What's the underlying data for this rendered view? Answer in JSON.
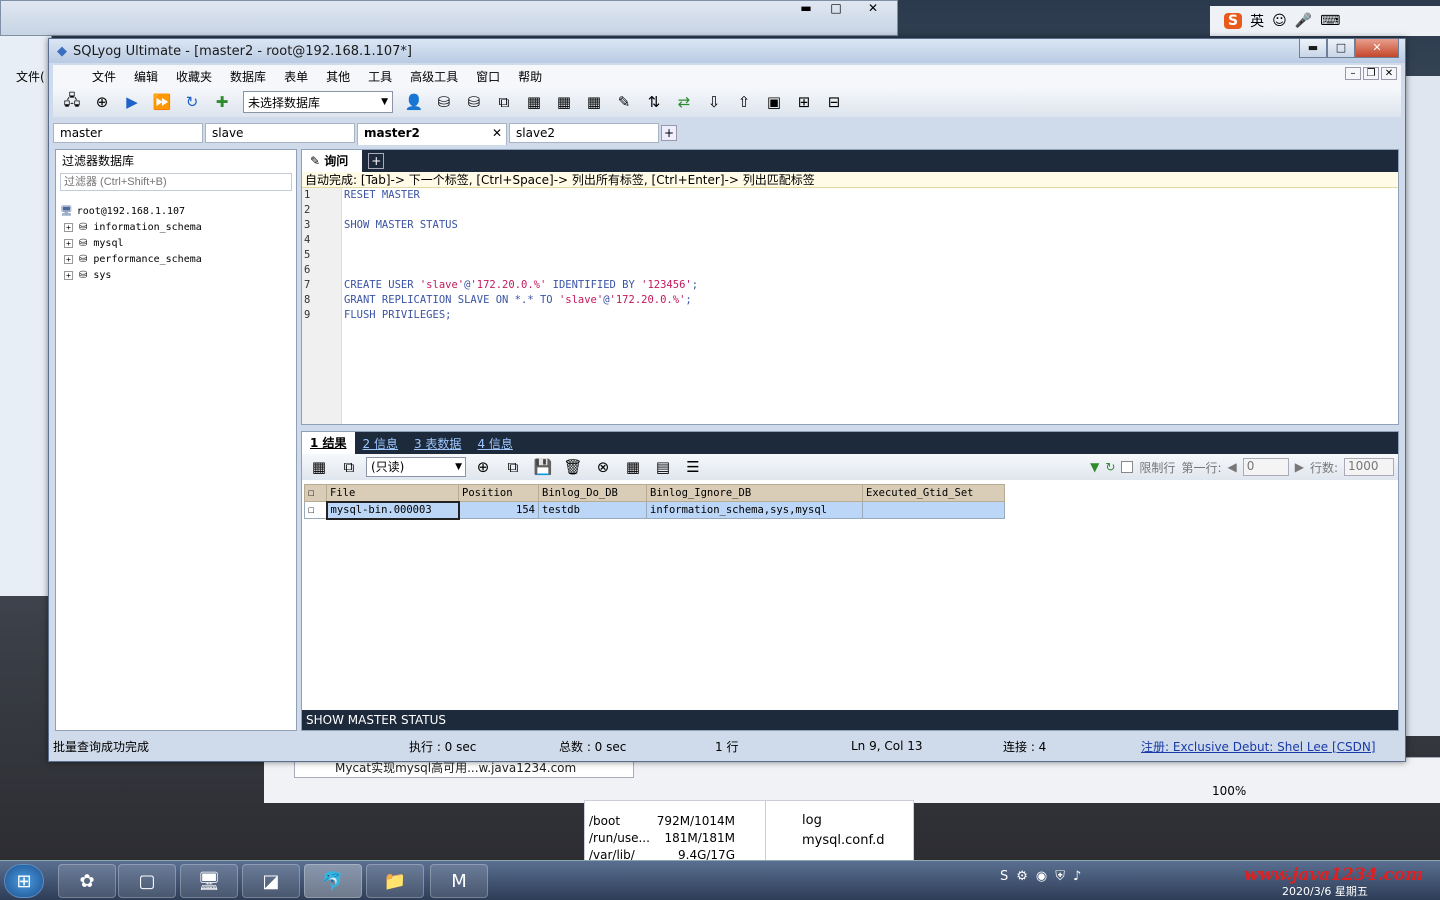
{
  "window": {
    "title": "SQLyog Ultimate - [master2 - root@192.168.1.107*]"
  },
  "menu": [
    "文件",
    "编辑",
    "收藏夹",
    "数据库",
    "表单",
    "其他",
    "工具",
    "高级工具",
    "窗口",
    "帮助"
  ],
  "toolbar": {
    "db_select": "未选择数据库"
  },
  "conn_tabs": [
    "master",
    "slave",
    "master2",
    "slave2"
  ],
  "left": {
    "header": "过滤器数据库",
    "filter_placeholder": "过滤器 (Ctrl+Shift+B)",
    "root": "root@192.168.1.107",
    "dbs": [
      "information_schema",
      "mysql",
      "performance_schema",
      "sys"
    ]
  },
  "query": {
    "tab": "询问",
    "autocomplete": "自动完成: [Tab]-> 下一个标签, [Ctrl+Space]-> 列出所有标签, [Ctrl+Enter]-> 列出匹配标签",
    "line_numbers": [
      "1",
      "2",
      "3",
      "4",
      "5",
      "6",
      "7",
      "8",
      "9"
    ],
    "l1": "RESET MASTER",
    "l3": "SHOW MASTER STATUS",
    "l7a": "CREATE USER ",
    "l7b": "'slave'",
    "l7c": "@",
    "l7d": "'172.20.0.%'",
    "l7e": " IDENTIFIED BY ",
    "l7f": "'123456'",
    "l7g": ";",
    "l8a": "GRANT REPLICATION SLAVE ON *.* TO ",
    "l8b": "'slave'",
    "l8c": "@",
    "l8d": "'172.20.0.%'",
    "l8e": ";",
    "l9": "FLUSH PRIVILEGES;"
  },
  "results": {
    "tabs": [
      "1 结果",
      "2 信息",
      "3 表数据",
      "4 信息"
    ],
    "mode": "(只读)",
    "limit_label": "限制行",
    "first_row_label": "第一行:",
    "first_row": "0",
    "rows_label": "行数:",
    "rows": "1000",
    "columns": [
      "File",
      "Position",
      "Binlog_Do_DB",
      "Binlog_Ignore_DB",
      "Executed_Gtid_Set"
    ],
    "row": [
      "mysql-bin.000003",
      "154",
      "testdb",
      "information_schema,sys,mysql",
      ""
    ],
    "sql_status": "SHOW MASTER STATUS"
  },
  "status": {
    "msg": "批量查询成功完成",
    "exec": "执行 : 0 sec",
    "total": "总数 : 0 sec",
    "rows": "1 行",
    "pos": "Ln 9, Col 13",
    "conn": "连接 : 4",
    "reg": "注册: Exclusive Debut: Shel Lee [CSDN]"
  },
  "background": {
    "browser_tab": "Mycat实现mysql高可用...w.java1234.com",
    "zoom": "100%",
    "files": [
      [
        "/boot",
        "792M/1014M"
      ],
      [
        "/run/use...",
        "181M/181M"
      ],
      [
        "/var/lib/",
        "9.4G/17G"
      ]
    ],
    "folders": [
      "log",
      "mysql.conf.d"
    ],
    "left_menu": "文件(",
    "watermark": "www.java1234.com",
    "clock_date": "2020/3/6 星期五",
    "ime": "英"
  }
}
